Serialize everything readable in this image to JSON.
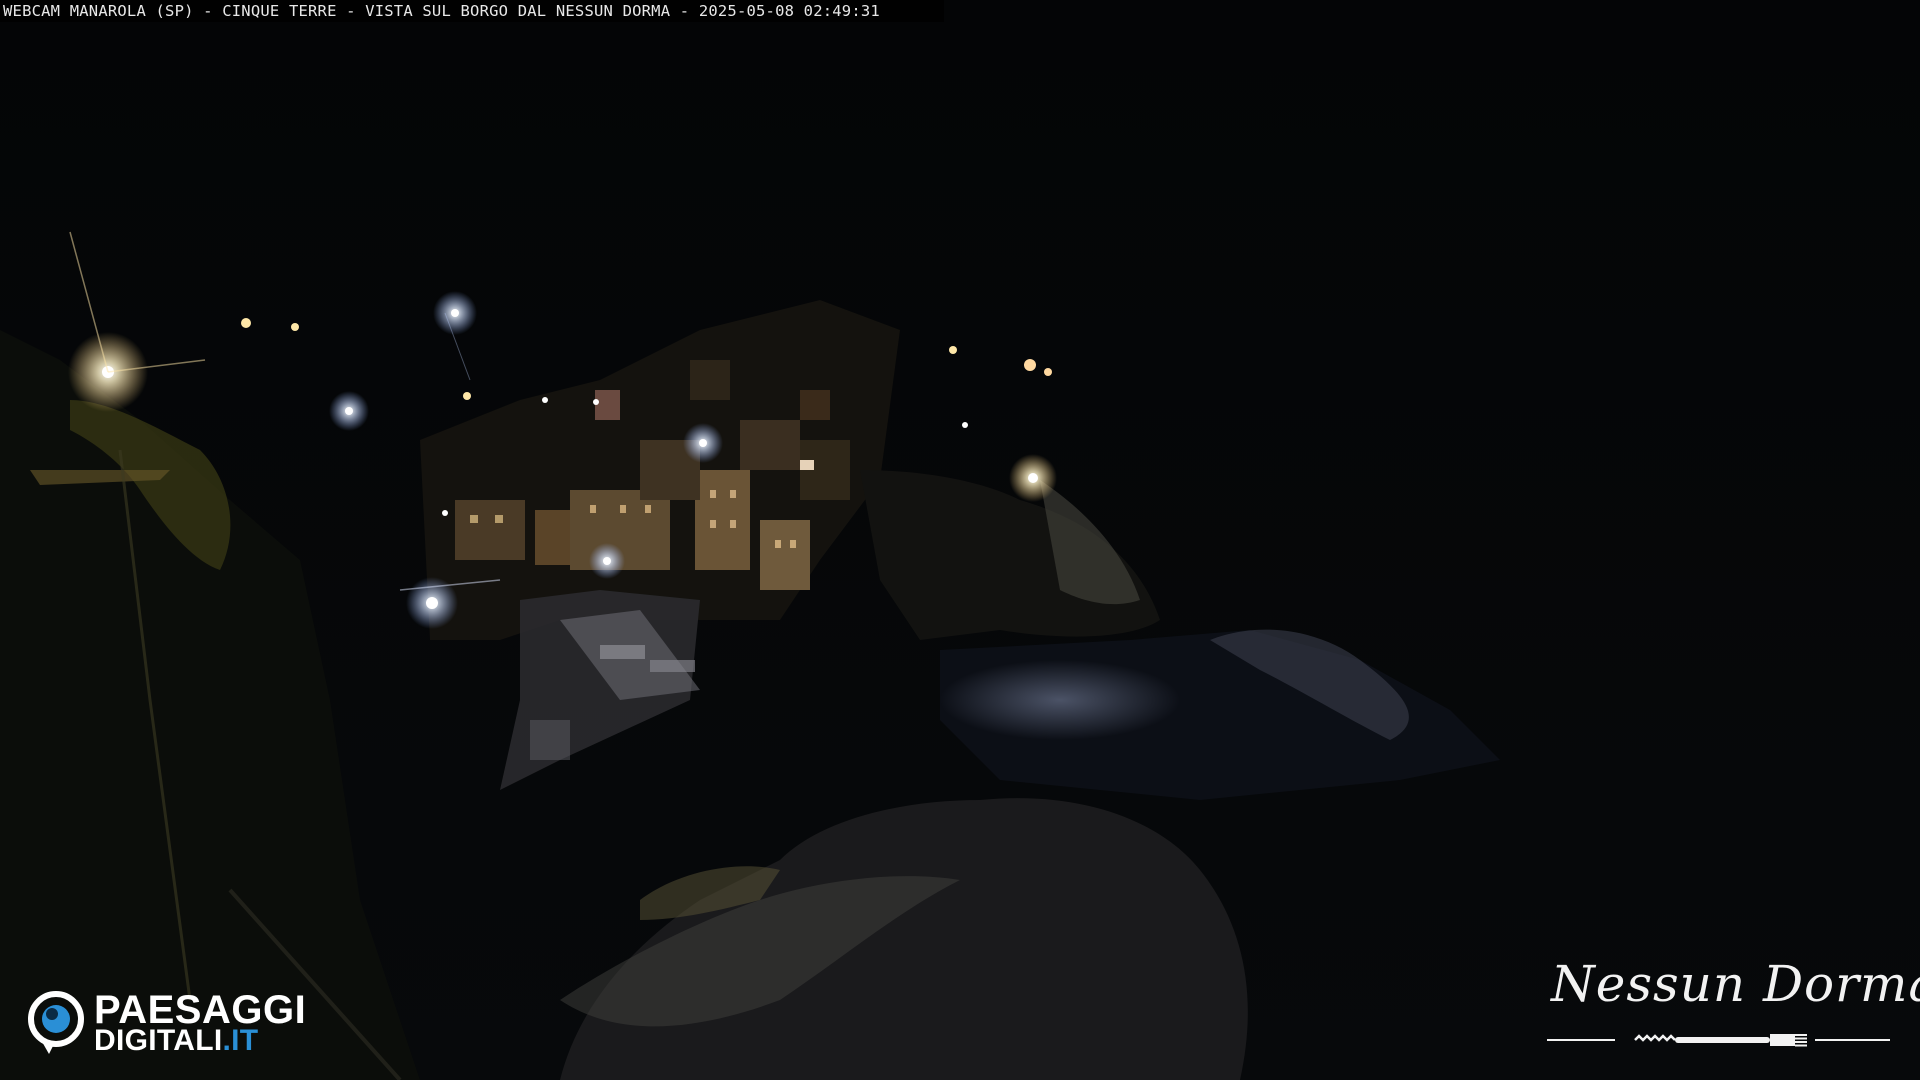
{
  "overlay": {
    "caption": "WEBCAM MANAROLA (SP) - CINQUE TERRE - VISTA SUL BORGO DAL NESSUN DORMA - 2025-05-08 02:49:31"
  },
  "logo_left": {
    "line1": "PAESAGGI",
    "line2_main": "DIGITALI",
    "line2_accent": ".IT",
    "accent_color": "#2a8fd6",
    "icon": "eye-icon"
  },
  "logo_right": {
    "script": "Nessun Dorma",
    "icon": "fork-icon"
  },
  "colors": {
    "sky": "#050607",
    "sea": "#0a0d12",
    "light": "#fff6d8"
  }
}
